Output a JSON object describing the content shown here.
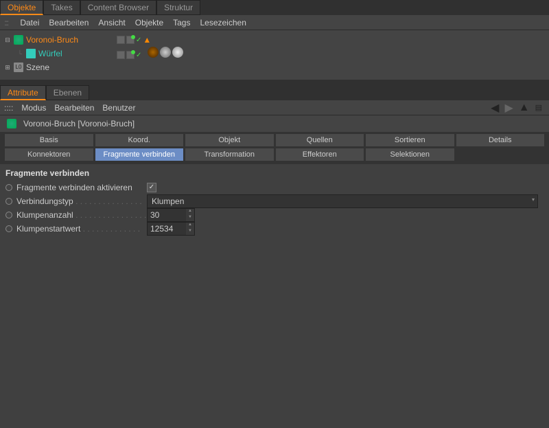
{
  "tabs_top": {
    "objekte": "Objekte",
    "takes": "Takes",
    "content_browser": "Content Browser",
    "struktur": "Struktur"
  },
  "menu_objects": {
    "datei": "Datei",
    "bearbeiten": "Bearbeiten",
    "ansicht": "Ansicht",
    "objekte": "Objekte",
    "tags": "Tags",
    "lesezeichen": "Lesezeichen"
  },
  "tree": {
    "voronoi": "Voronoi-Bruch",
    "wuerfel": "Würfel",
    "szene": "Szene"
  },
  "tabs_attr": {
    "attribute": "Attribute",
    "ebenen": "Ebenen"
  },
  "menu_attr": {
    "modus": "Modus",
    "bearbeiten": "Bearbeiten",
    "benutzer": "Benutzer"
  },
  "obj_title": "Voronoi-Bruch [Voronoi-Bruch]",
  "prop_tabs": {
    "basis": "Basis",
    "koord": "Koord.",
    "objekt": "Objekt",
    "quellen": "Quellen",
    "sortieren": "Sortieren",
    "details": "Details",
    "konnektoren": "Konnektoren",
    "fragmente_verbinden": "Fragmente verbinden",
    "transformation": "Transformation",
    "effektoren": "Effektoren",
    "selektionen": "Selektionen"
  },
  "section": "Fragmente verbinden",
  "fields": {
    "aktivieren_label": "Fragmente verbinden aktivieren",
    "aktivieren_checked": "✓",
    "verbindungstyp_label": "Verbindungstyp",
    "verbindungstyp_value": "Klumpen",
    "klumpenanzahl_label": "Klumpenanzahl",
    "klumpenanzahl_value": "30",
    "klumpenstart_label": "Klumpenstartwert",
    "klumpenstart_value": "12534"
  }
}
